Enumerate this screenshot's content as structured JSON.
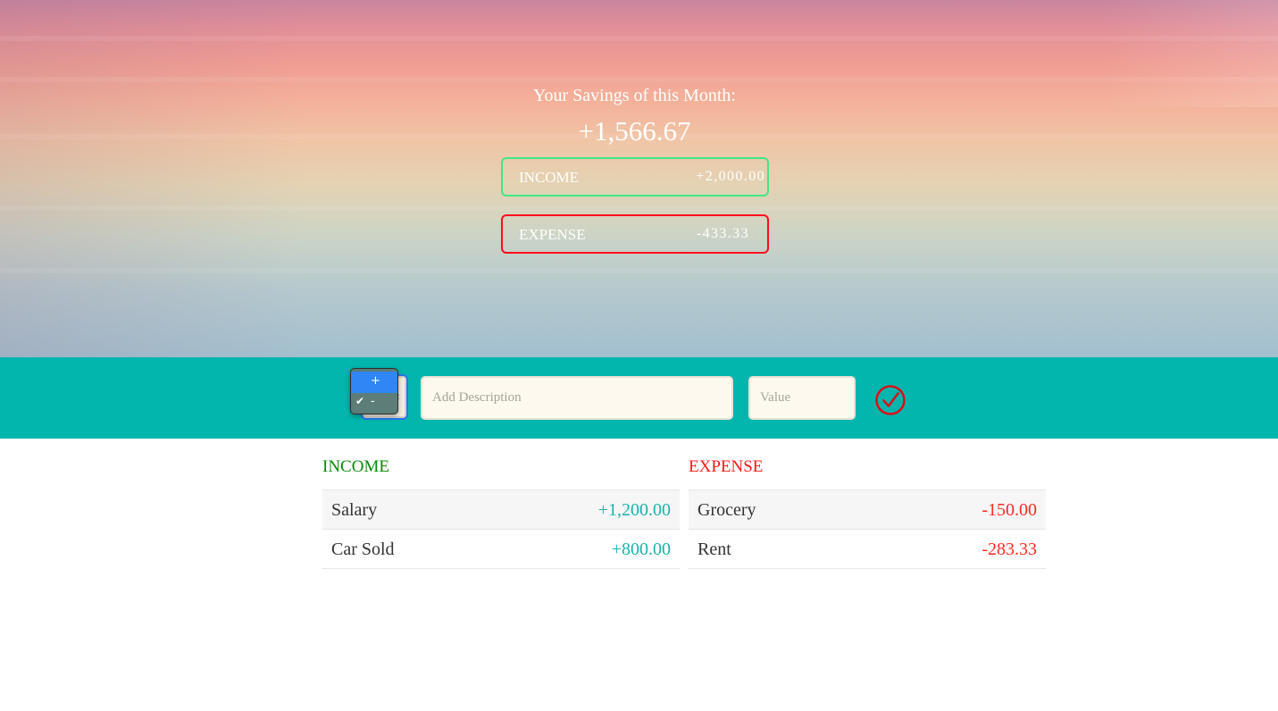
{
  "header": {
    "title": "Your Savings of this Month:",
    "total": "+1,566.67",
    "income": {
      "label": "INCOME",
      "value": "+2,000.00"
    },
    "expense": {
      "label": "EXPENSE",
      "value": "-433.33"
    }
  },
  "add_bar": {
    "type_options": [
      "+",
      "-"
    ],
    "selected_type": "-",
    "description_placeholder": "Add Description",
    "value_placeholder": "Value",
    "submit_icon": "check-circle-icon"
  },
  "income_list": {
    "heading": "INCOME",
    "items": [
      {
        "description": "Salary",
        "value": "+1,200.00"
      },
      {
        "description": "Car Sold",
        "value": "+800.00"
      }
    ]
  },
  "expense_list": {
    "heading": "EXPENSE",
    "items": [
      {
        "description": "Grocery",
        "value": "-150.00"
      },
      {
        "description": "Rent",
        "value": "-283.33"
      }
    ]
  },
  "colors": {
    "accent": "#02b6ad",
    "income_border": "#3ee883",
    "expense_border": "#ff0c1c",
    "income_text": "#17b3ae",
    "expense_text": "#ff2a22",
    "income_heading": "#078a07"
  }
}
